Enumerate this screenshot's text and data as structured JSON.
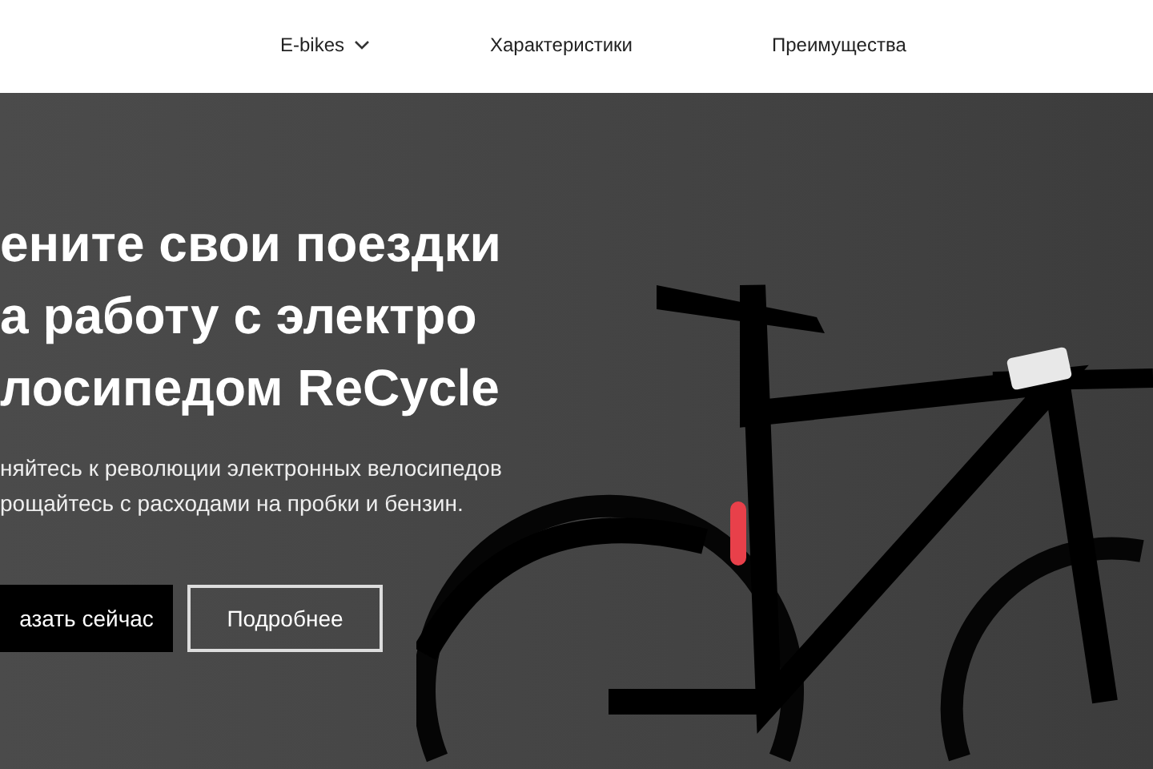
{
  "nav": {
    "items": [
      {
        "label": "E-bikes",
        "has_dropdown": true
      },
      {
        "label": "Характеристики",
        "has_dropdown": false
      },
      {
        "label": "Преимущества",
        "has_dropdown": false
      }
    ]
  },
  "hero": {
    "heading_lines": [
      "ените свои поездки",
      "а работу с электро",
      "лосипедом ReCycle"
    ],
    "subtitle_lines": [
      "няйтесь к революции электронных велосипедов",
      "рощайтесь с расходами на пробки и бензин."
    ],
    "buttons": [
      {
        "label": "азать сейчас",
        "kind": "solid"
      },
      {
        "label": "Подробнее",
        "kind": "outline"
      }
    ]
  }
}
